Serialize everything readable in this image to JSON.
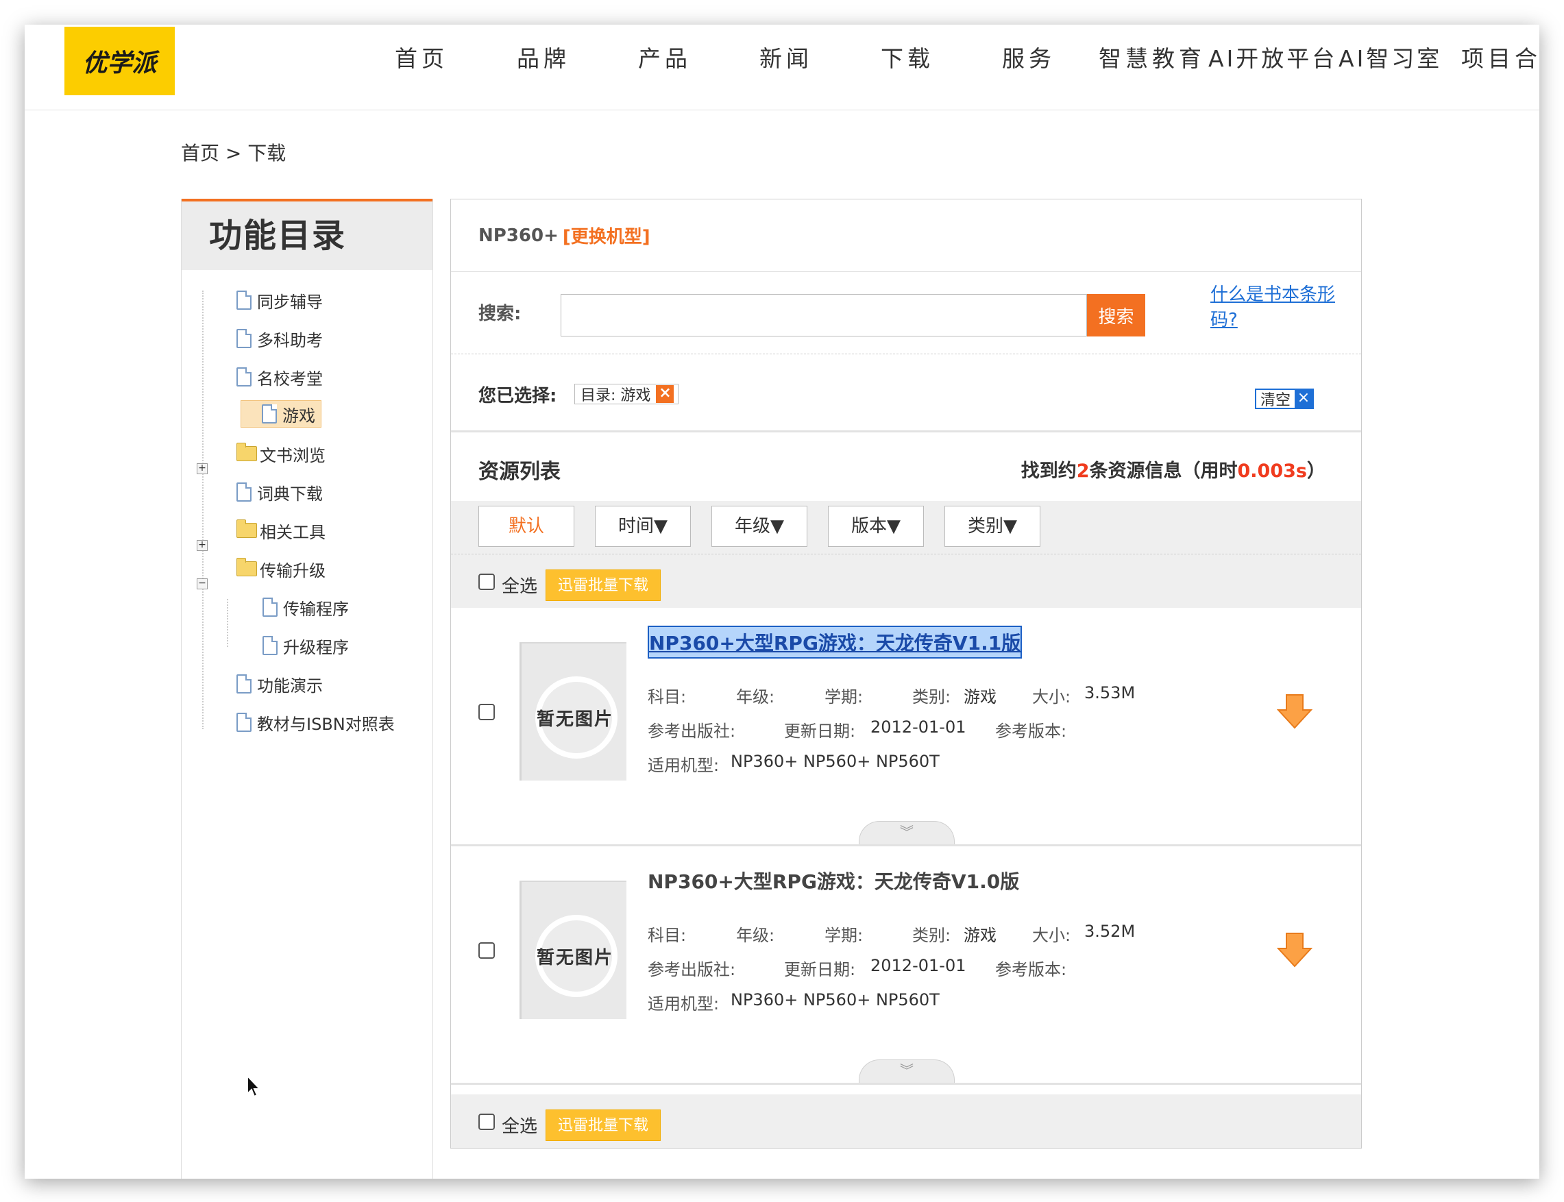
{
  "logo": {
    "text": "优学派"
  },
  "nav": [
    "首页",
    "品牌",
    "产品",
    "新闻",
    "下载",
    "服务",
    "智慧教育",
    "AI开放平台",
    "AI智习室",
    "项目合作"
  ],
  "breadcrumb": "首页 > 下载",
  "sidebar": {
    "title": "功能目录",
    "items": [
      {
        "label": "同步辅导",
        "type": "doc"
      },
      {
        "label": "多科助考",
        "type": "doc"
      },
      {
        "label": "名校考堂",
        "type": "doc"
      },
      {
        "label": "游戏",
        "type": "doc",
        "selected": true
      },
      {
        "label": "文书浏览",
        "type": "folder",
        "expand": "+"
      },
      {
        "label": "词典下载",
        "type": "doc"
      },
      {
        "label": "相关工具",
        "type": "folder",
        "expand": "+"
      },
      {
        "label": "传输升级",
        "type": "folder",
        "expand": "-"
      },
      {
        "label": "传输程序",
        "type": "doc",
        "child": true
      },
      {
        "label": "升级程序",
        "type": "doc",
        "child": true
      },
      {
        "label": "功能演示",
        "type": "doc"
      },
      {
        "label": "教材与ISBN对照表",
        "type": "doc"
      }
    ]
  },
  "main": {
    "model": "NP360+",
    "change_model": "[更换机型]",
    "search_label": "搜索:",
    "search_value": "",
    "search_button": "搜索",
    "isbn_link": "什么是书本条形码? ",
    "selected_label": "您已选择:",
    "filter_chip": "目录: 游戏",
    "clear_label": "清空",
    "list_title": "资源列表",
    "summary": {
      "prefix": "找到约",
      "count": "2",
      "middle": "条资源信息（用时",
      "time": "0.003s",
      "suffix": "）"
    },
    "sort_buttons": [
      "默认",
      "时间▼",
      "年级▼",
      "版本▼",
      "类别▼"
    ],
    "select_all": "全选",
    "batch_download": "迅雷批量下载",
    "thumb_placeholder": "暂无图片",
    "items": [
      {
        "title": "NP360+大型RPG游戏：天龙传奇V1.1版",
        "subject_label": "科目:",
        "grade_label": "年级:",
        "term_label": "学期:",
        "category_label": "类别:",
        "category": "游戏",
        "size_label": "大小:",
        "size": "3.53M",
        "publisher_label": "参考出版社:",
        "date_label": "更新日期:",
        "date": "2012-01-01",
        "version_label": "参考版本:",
        "models_label": "适用机型:",
        "models": "NP360+ NP560+ NP560T"
      },
      {
        "title": "NP360+大型RPG游戏：天龙传奇V1.0版",
        "subject_label": "科目:",
        "grade_label": "年级:",
        "term_label": "学期:",
        "category_label": "类别:",
        "category": "游戏",
        "size_label": "大小:",
        "size": "3.52M",
        "publisher_label": "参考出版社:",
        "date_label": "更新日期:",
        "date": "2012-01-01",
        "version_label": "参考版本:",
        "models_label": "适用机型:",
        "models": "NP360+ NP560+ NP560T"
      }
    ]
  },
  "colors": {
    "accent": "#f37021",
    "logo_bg": "#fccd00",
    "link": "#1e6fd6",
    "batch": "#fdc02e"
  }
}
